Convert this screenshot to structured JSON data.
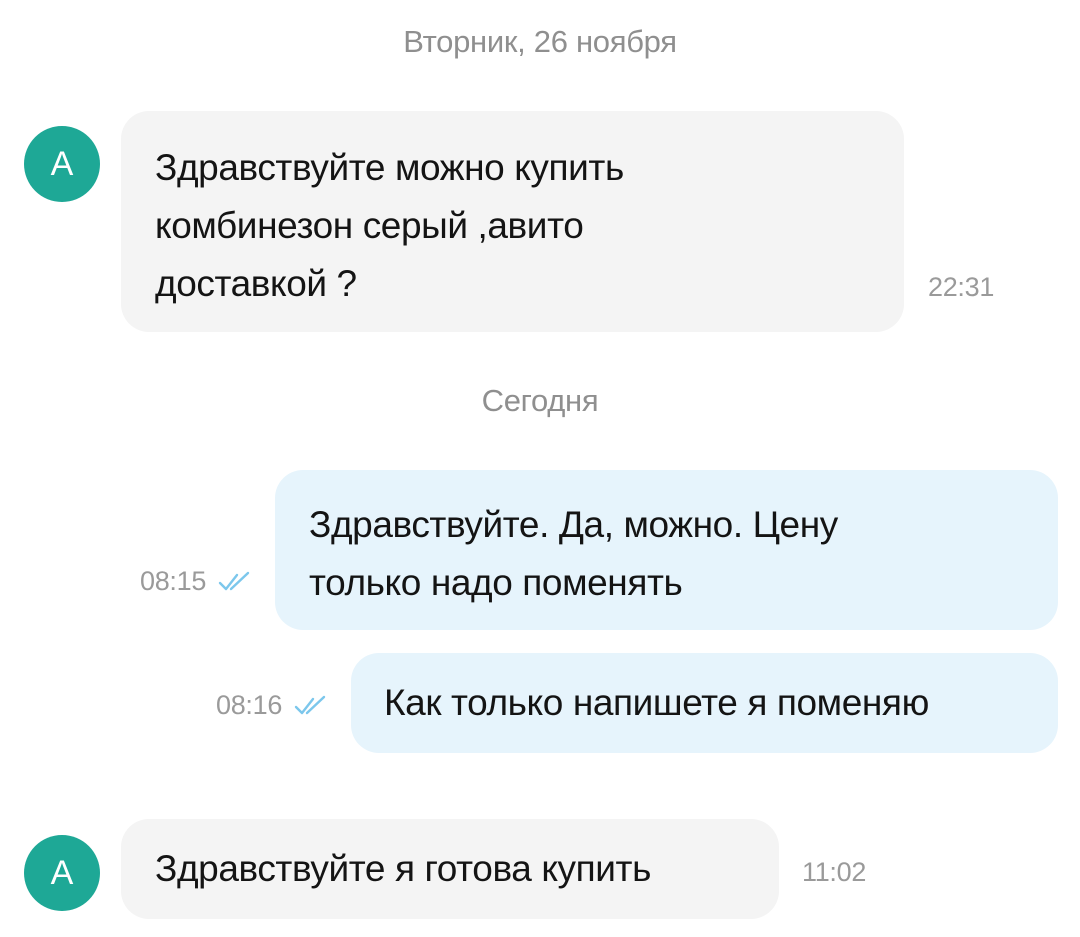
{
  "date_separators": {
    "first": "Вторник, 26 ноября",
    "second": "Сегодня"
  },
  "messages": [
    {
      "direction": "incoming",
      "avatar_letter": "А",
      "lines": [
        "Здравствуйте можно купить",
        "комбинезон серый ,авито",
        "доставкой ?"
      ],
      "time": "22:31"
    },
    {
      "direction": "outgoing",
      "lines": [
        "Здравствуйте. Да, можно. Цену",
        "только надо поменять"
      ],
      "time": "08:15",
      "status_icon": "double-check-icon"
    },
    {
      "direction": "outgoing",
      "lines": [
        "Как только напишете я поменяю"
      ],
      "time": "08:16",
      "status_icon": "double-check-icon"
    },
    {
      "direction": "incoming",
      "avatar_letter": "А",
      "lines": [
        "Здравствуйте я готова купить"
      ],
      "time": "11:02"
    }
  ],
  "colors": {
    "avatar": "#1ea896",
    "incoming_bubble": "#f4f4f4",
    "outgoing_bubble": "#e6f4fc",
    "read_check": "#7cc7ec",
    "muted_text": "#8f8f8f"
  }
}
